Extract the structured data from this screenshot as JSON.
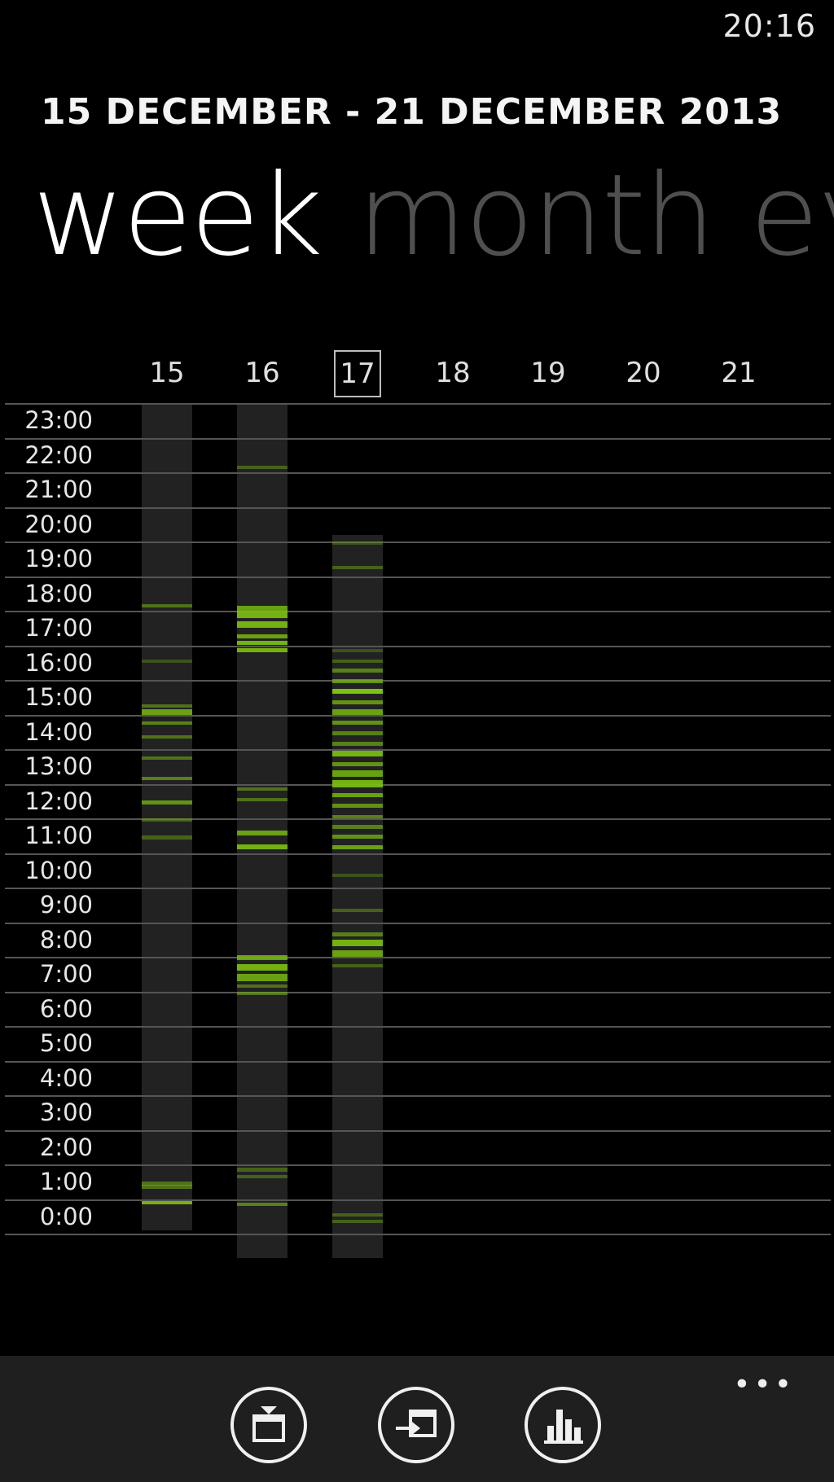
{
  "status": {
    "time": "20:16"
  },
  "header": {
    "range": "15 DECEMBER - 21 DECEMBER 2013"
  },
  "pivot": {
    "tabs": [
      "week",
      "month",
      "ev"
    ]
  },
  "chart_data": {
    "type": "heatmap",
    "days": [
      "15",
      "16",
      "17",
      "18",
      "19",
      "20",
      "21"
    ],
    "selected_day": "17",
    "hours": [
      "23:00",
      "22:00",
      "21:00",
      "20:00",
      "19:00",
      "18:00",
      "17:00",
      "16:00",
      "15:00",
      "14:00",
      "13:00",
      "12:00",
      "11:00",
      "10:00",
      "9:00",
      "8:00",
      "7:00",
      "6:00",
      "5:00",
      "4:00",
      "3:00",
      "2:00",
      "1:00",
      "0:00"
    ],
    "bar_color": "#7cc20f",
    "columns": [
      {
        "day": "15",
        "span": [
          0.8,
          24
        ],
        "marks": [
          [
            0.85,
            0.1,
            0.9
          ],
          [
            1.3,
            0.12,
            0.5
          ],
          [
            1.4,
            0.1,
            0.5
          ],
          [
            11.4,
            0.1,
            0.4
          ],
          [
            11.9,
            0.1,
            0.4
          ],
          [
            12.4,
            0.12,
            0.7
          ],
          [
            13.1,
            0.1,
            0.6
          ],
          [
            13.7,
            0.1,
            0.5
          ],
          [
            14.3,
            0.1,
            0.5
          ],
          [
            14.7,
            0.1,
            0.6
          ],
          [
            15.0,
            0.15,
            0.8
          ],
          [
            15.2,
            0.1,
            0.5
          ],
          [
            16.5,
            0.1,
            0.3
          ],
          [
            18.1,
            0.1,
            0.5
          ]
        ]
      },
      {
        "day": "16",
        "span": [
          0,
          24
        ],
        "marks": [
          [
            0.8,
            0.1,
            0.6
          ],
          [
            1.6,
            0.1,
            0.4
          ],
          [
            1.8,
            0.1,
            0.4
          ],
          [
            6.9,
            0.1,
            0.5
          ],
          [
            7.1,
            0.1,
            0.5
          ],
          [
            7.3,
            0.2,
            0.8
          ],
          [
            7.6,
            0.2,
            0.9
          ],
          [
            7.9,
            0.15,
            0.8
          ],
          [
            11.1,
            0.15,
            0.9
          ],
          [
            11.5,
            0.15,
            0.8
          ],
          [
            12.5,
            0.1,
            0.5
          ],
          [
            12.8,
            0.1,
            0.5
          ],
          [
            16.8,
            0.12,
            0.9
          ],
          [
            17.0,
            0.12,
            0.9
          ],
          [
            17.2,
            0.12,
            0.8
          ],
          [
            17.5,
            0.2,
            0.9
          ],
          [
            17.8,
            0.2,
            0.9
          ],
          [
            18.0,
            0.15,
            0.8
          ],
          [
            22.1,
            0.1,
            0.4
          ]
        ]
      },
      {
        "day": "17",
        "span": [
          0,
          20.2
        ],
        "marks": [
          [
            0.3,
            0.1,
            0.4
          ],
          [
            0.5,
            0.1,
            0.4
          ],
          [
            7.7,
            0.1,
            0.4
          ],
          [
            8.0,
            0.2,
            0.8
          ],
          [
            8.3,
            0.2,
            0.9
          ],
          [
            8.6,
            0.1,
            0.6
          ],
          [
            9.3,
            0.1,
            0.4
          ],
          [
            10.3,
            0.1,
            0.3
          ],
          [
            11.1,
            0.12,
            0.8
          ],
          [
            11.4,
            0.12,
            0.7
          ],
          [
            11.7,
            0.12,
            0.6
          ],
          [
            12.0,
            0.1,
            0.6
          ],
          [
            12.3,
            0.12,
            0.7
          ],
          [
            12.6,
            0.12,
            0.8
          ],
          [
            12.9,
            0.2,
            0.9
          ],
          [
            13.2,
            0.2,
            0.8
          ],
          [
            13.5,
            0.12,
            0.7
          ],
          [
            13.8,
            0.15,
            0.9
          ],
          [
            14.1,
            0.12,
            0.6
          ],
          [
            14.4,
            0.12,
            0.6
          ],
          [
            14.7,
            0.12,
            0.7
          ],
          [
            15.0,
            0.15,
            0.8
          ],
          [
            15.3,
            0.12,
            0.7
          ],
          [
            15.6,
            0.15,
            1.0
          ],
          [
            15.9,
            0.12,
            0.7
          ],
          [
            16.2,
            0.12,
            0.6
          ],
          [
            16.5,
            0.1,
            0.4
          ],
          [
            16.8,
            0.1,
            0.3
          ],
          [
            19.2,
            0.1,
            0.4
          ],
          [
            19.9,
            0.1,
            0.3
          ]
        ]
      }
    ]
  },
  "app_bar": {
    "buttons": [
      "calendar-download-icon",
      "calendar-import-icon",
      "bar-chart-icon"
    ],
    "more": "•••"
  }
}
